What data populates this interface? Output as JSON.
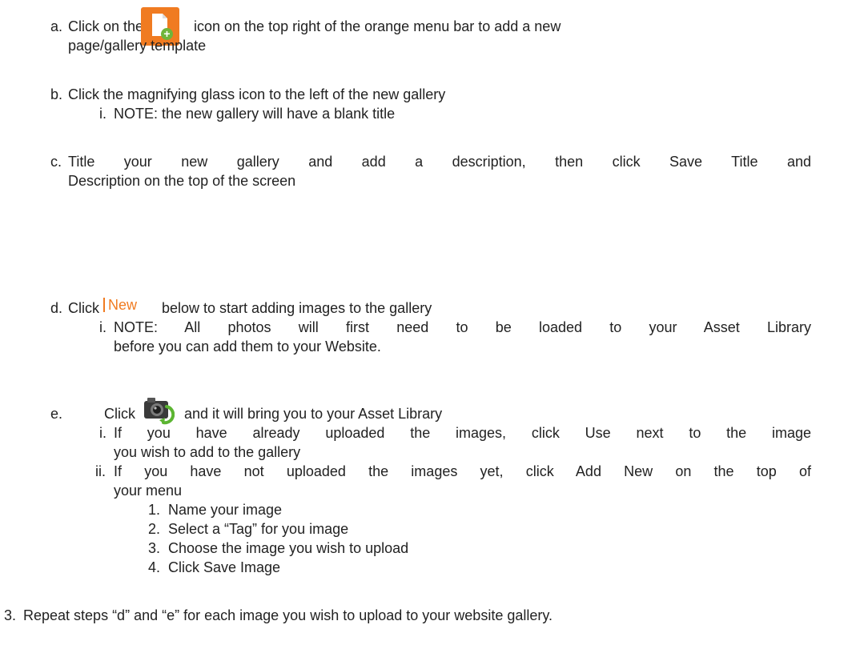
{
  "icons": {
    "add_page": "add-page-icon",
    "new_button": "new-button-icon",
    "camera": "camera-refresh-icon"
  },
  "colors": {
    "menu_orange": "#f07b21",
    "plus_green": "#6fb53a"
  },
  "step_a": {
    "marker": "a.",
    "text_before": "Click on the",
    "text_after": "icon on the top right of the orange menu bar to add a new",
    "text_line2": "page/gallery template"
  },
  "step_b": {
    "marker": "b.",
    "text": "Click the magnifying glass icon to the left of the new gallery",
    "note_marker": "i.",
    "note": "NOTE: the new gallery will have a blank title"
  },
  "step_c": {
    "marker": "c.",
    "line1": "Title your new gallery and add a description, then click Save Title and",
    "line2": "Description on the top of the screen"
  },
  "step_d": {
    "marker": "d.",
    "text_before": "Click",
    "new_label": "New",
    "text_after": "below to start adding images to the gallery",
    "note_marker": "i.",
    "note_line1": "NOTE: All photos will first need to be loaded to your Asset Library",
    "note_line2": "before you can add them to your Website."
  },
  "step_e": {
    "marker": "e.",
    "text_before": "Click",
    "text_after": "and it will bring you to your Asset Library",
    "sub1_marker": "i.",
    "sub1_line1": "If you have already uploaded the images, click Use next to the image",
    "sub1_line2": "you wish to add to the gallery",
    "sub2_marker": "ii.",
    "sub2_line1": "If you have not uploaded the images yet, click Add New on the top of",
    "sub2_line2": "your menu",
    "substeps": [
      {
        "num": "1.",
        "text": "Name your image"
      },
      {
        "num": "2.",
        "text": "Select a “Tag” for you image"
      },
      {
        "num": "3.",
        "text": "Choose the image you wish to upload"
      },
      {
        "num": "4.",
        "text": "Click Save Image"
      }
    ]
  },
  "step_3": {
    "marker": "3.",
    "text": "Repeat steps “d” and “e” for each image you wish to upload to your website gallery."
  }
}
